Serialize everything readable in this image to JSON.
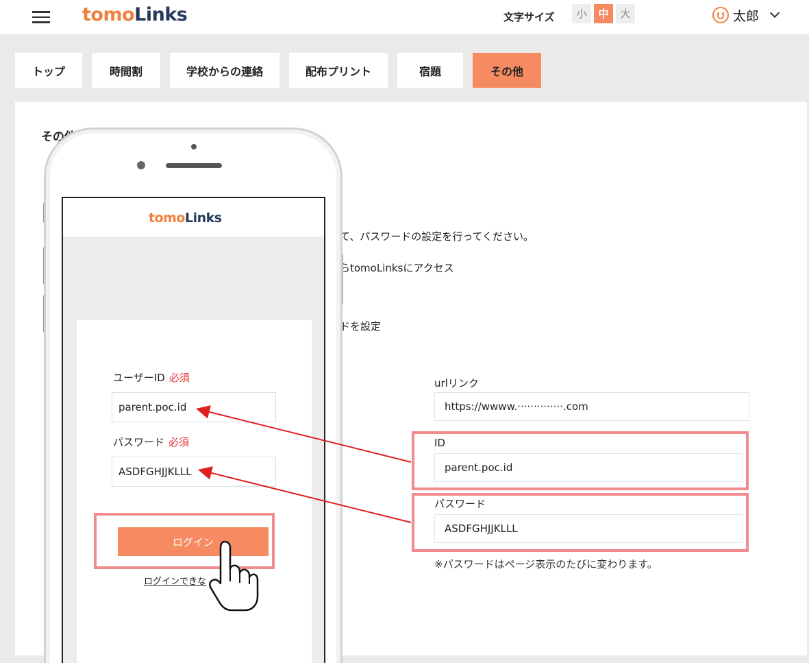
{
  "header": {
    "logo_tomo": "tomo",
    "logo_links": "Links",
    "font_size_label": "文字サイズ",
    "font_sizes": [
      "小",
      "中",
      "大"
    ],
    "active_font_size": "中",
    "user_name": "太郎"
  },
  "tabs": [
    {
      "label": "トップ"
    },
    {
      "label": "時間割"
    },
    {
      "label": "学校からの連絡"
    },
    {
      "label": "配布プリント"
    },
    {
      "label": "宿題"
    },
    {
      "label": "その他",
      "active": true
    }
  ],
  "main": {
    "section_title": "その他",
    "desc_line1": "て、パスワードの設定を行ってください。",
    "desc_line2": "らtomoLinksにアクセス",
    "desc_line3": "ドを設定",
    "url_label": "urlリンク",
    "url_value": "https://wwww.··············.com",
    "id_label": "ID",
    "id_value": "parent.poc.id",
    "password_label": "パスワード",
    "password_value": "ASDFGHJJKLLL",
    "note": "※パスワードはページ表示のたびに変わります。"
  },
  "phone": {
    "logo_tomo": "tomo",
    "logo_links": "Links",
    "user_id_label": "ユーザーID",
    "required": "必須",
    "user_id_value": "parent.poc.id",
    "password_label": "パスワード",
    "password_value": "ASDFGHJJKLLL",
    "login_button": "ログイン",
    "login_link": "ログインできな"
  },
  "colors": {
    "accent": "#f68a60",
    "logo_tomo": "#f0803d",
    "logo_links": "#263a5b",
    "highlight": "#f28b8e",
    "arrow": "#e02020",
    "required": "#e63535"
  }
}
